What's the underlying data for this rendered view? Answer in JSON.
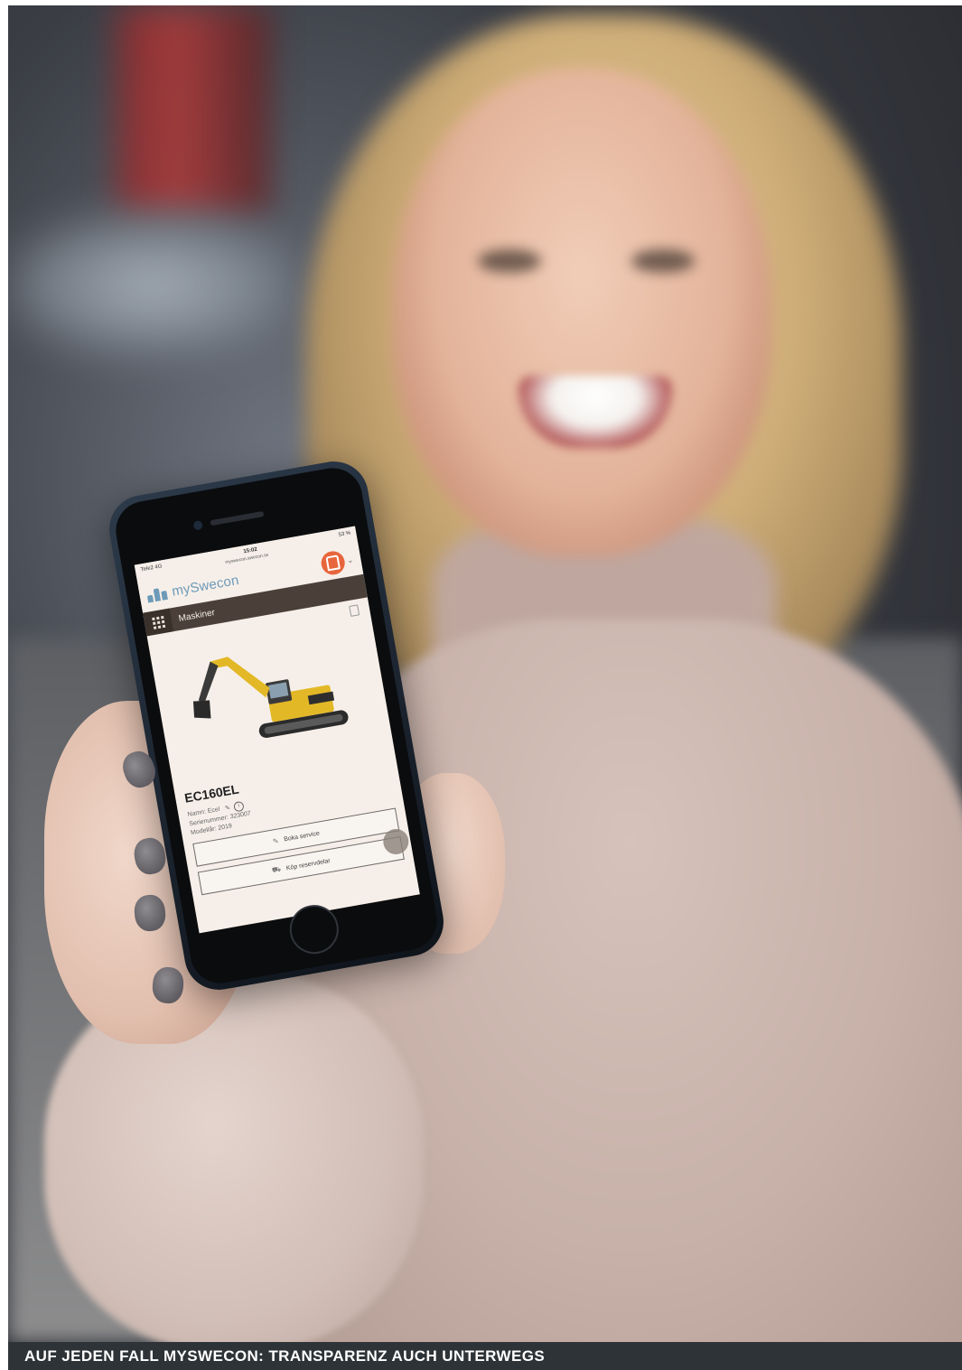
{
  "caption": "AUF JEDEN FALL MYSWECON: TRANSPARENZ AUCH UNTERWEGS",
  "phone": {
    "status": {
      "carrier": "Tele2 4G",
      "time": "15:02",
      "battery": "53 %",
      "url": "myswecon.swecon.se"
    },
    "app": {
      "logo_text": "mySwecon",
      "brand_color": "#6d9ab8",
      "avatar_color": "#e8663d",
      "nav_title": "Maskiner",
      "machine": {
        "model": "EC160EL",
        "name_line": "Namn: Ecel",
        "serial_line": "Serienummer: 323007",
        "year_line": "Modellår: 2019"
      },
      "buttons": {
        "service": "Boka service",
        "parts": "Köp reservdelar"
      }
    }
  }
}
